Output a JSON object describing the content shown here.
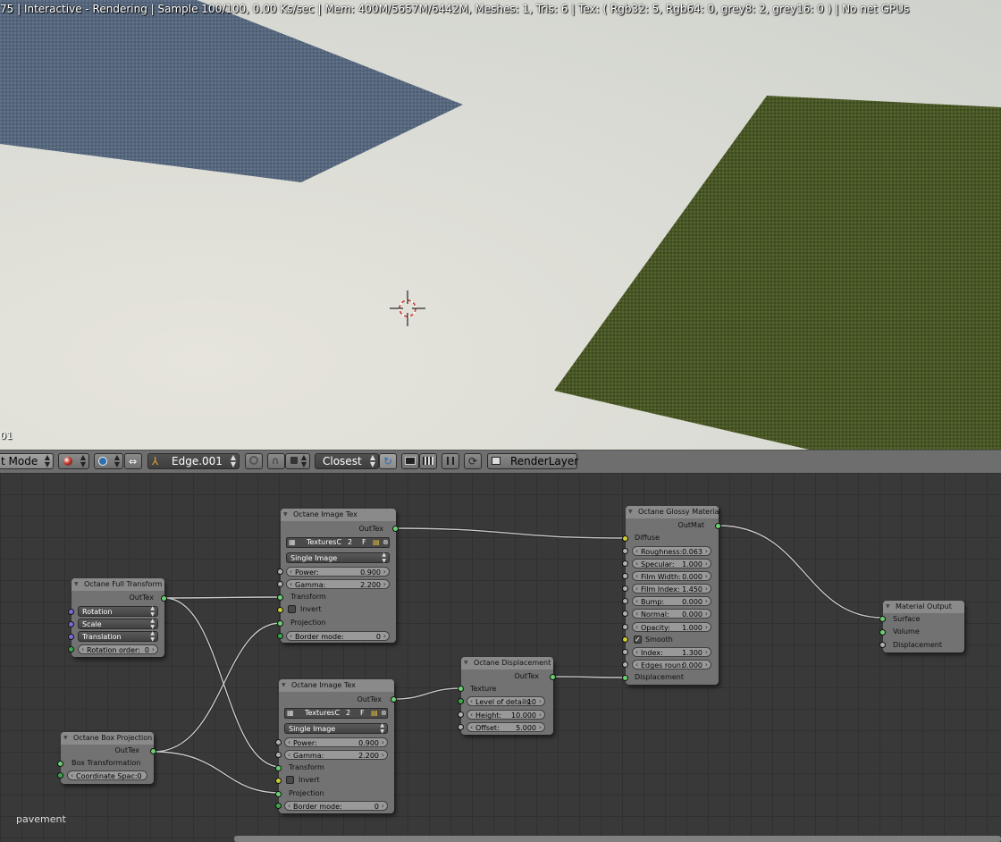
{
  "viewport": {
    "status": "75 | Interactive - Rendering | Sample 100/100, 0.00 Ks/sec | Mem: 400M/5657M/6442M, Meshes: 1, Tris: 6 | Tex: ( Rgb32: 5, Rgb64: 0, grey8: 2, grey16: 0 ) | No net GPUs",
    "frame": "01"
  },
  "header": {
    "mode_label": "t Mode",
    "uv_map": "Edge.001",
    "snap_element": "Closest",
    "render_layer": "RenderLayer"
  },
  "nodes": {
    "full_transform": {
      "title": "Octane Full Transform",
      "out": "OutTex",
      "rotation": "Rotation",
      "scale": "Scale",
      "translation": "Translation",
      "rotation_order_label": "Rotation order:",
      "rotation_order_value": "0"
    },
    "box_projection": {
      "title": "Octane Box Projection",
      "out": "OutTex",
      "box_transformation": "Box Transformation",
      "coordinate_space": "Coordinate Spac:0"
    },
    "image_tex_1": {
      "title": "Octane Image Tex",
      "out": "OutTex",
      "texture_name": "TexturesC",
      "users": "2",
      "fake": "F",
      "mode": "Single Image",
      "power_label": "Power:",
      "power_value": "0.900",
      "gamma_label": "Gamma:",
      "gamma_value": "2.200",
      "transform": "Transform",
      "invert": "Invert",
      "projection": "Projection",
      "border_label": "Border mode:",
      "border_value": "0"
    },
    "image_tex_2": {
      "title": "Octane Image Tex",
      "out": "OutTex",
      "texture_name": "TexturesC",
      "users": "2",
      "fake": "F",
      "mode": "Single Image",
      "power_label": "Power:",
      "power_value": "0.900",
      "gamma_label": "Gamma:",
      "gamma_value": "2.200",
      "transform": "Transform",
      "invert": "Invert",
      "projection": "Projection",
      "border_label": "Border mode:",
      "border_value": "0"
    },
    "displacement": {
      "title": "Octane Displacement",
      "out": "OutTex",
      "texture": "Texture",
      "lod_label": "Level of details:",
      "lod_value": "10",
      "height_label": "Height:",
      "height_value": "10.000",
      "offset_label": "Offset:",
      "offset_value": "5.000"
    },
    "glossy": {
      "title": "Octane Glossy Material",
      "out": "OutMat",
      "diffuse": "Diffuse",
      "roughness_label": "Roughness:",
      "roughness_value": "0.063",
      "specular_label": "Specular:",
      "specular_value": "1.000",
      "film_width_label": "Film Width:",
      "film_width_value": "0.000",
      "film_index_label": "Film Index:",
      "film_index_value": "1.450",
      "bump_label": "Bump:",
      "bump_value": "0.000",
      "normal_label": "Normal:",
      "normal_value": "0.000",
      "opacity_label": "Opacity:",
      "opacity_value": "1.000",
      "smooth": "Smooth",
      "index_label": "Index:",
      "index_value": "1.300",
      "edges_label": "Edges roun:",
      "edges_value": "0.000",
      "displacement": "Displacement"
    },
    "material_output": {
      "title": "Material Output",
      "surface": "Surface",
      "volume": "Volume",
      "displacement": "Displacement"
    }
  },
  "material_name": "pavement",
  "colors": {
    "socket_texture": "#6cd070",
    "socket_color": "#cccc33",
    "socket_value": "#b0b0b0",
    "socket_vector": "#7a6cd6",
    "node_body": "#727272",
    "node_header": "#8a8a8a",
    "editor_bg": "#393939",
    "header_bar": "#6e6e6e",
    "plane_blue": "#5a6a80",
    "plane_green": "#4c5a2a"
  }
}
